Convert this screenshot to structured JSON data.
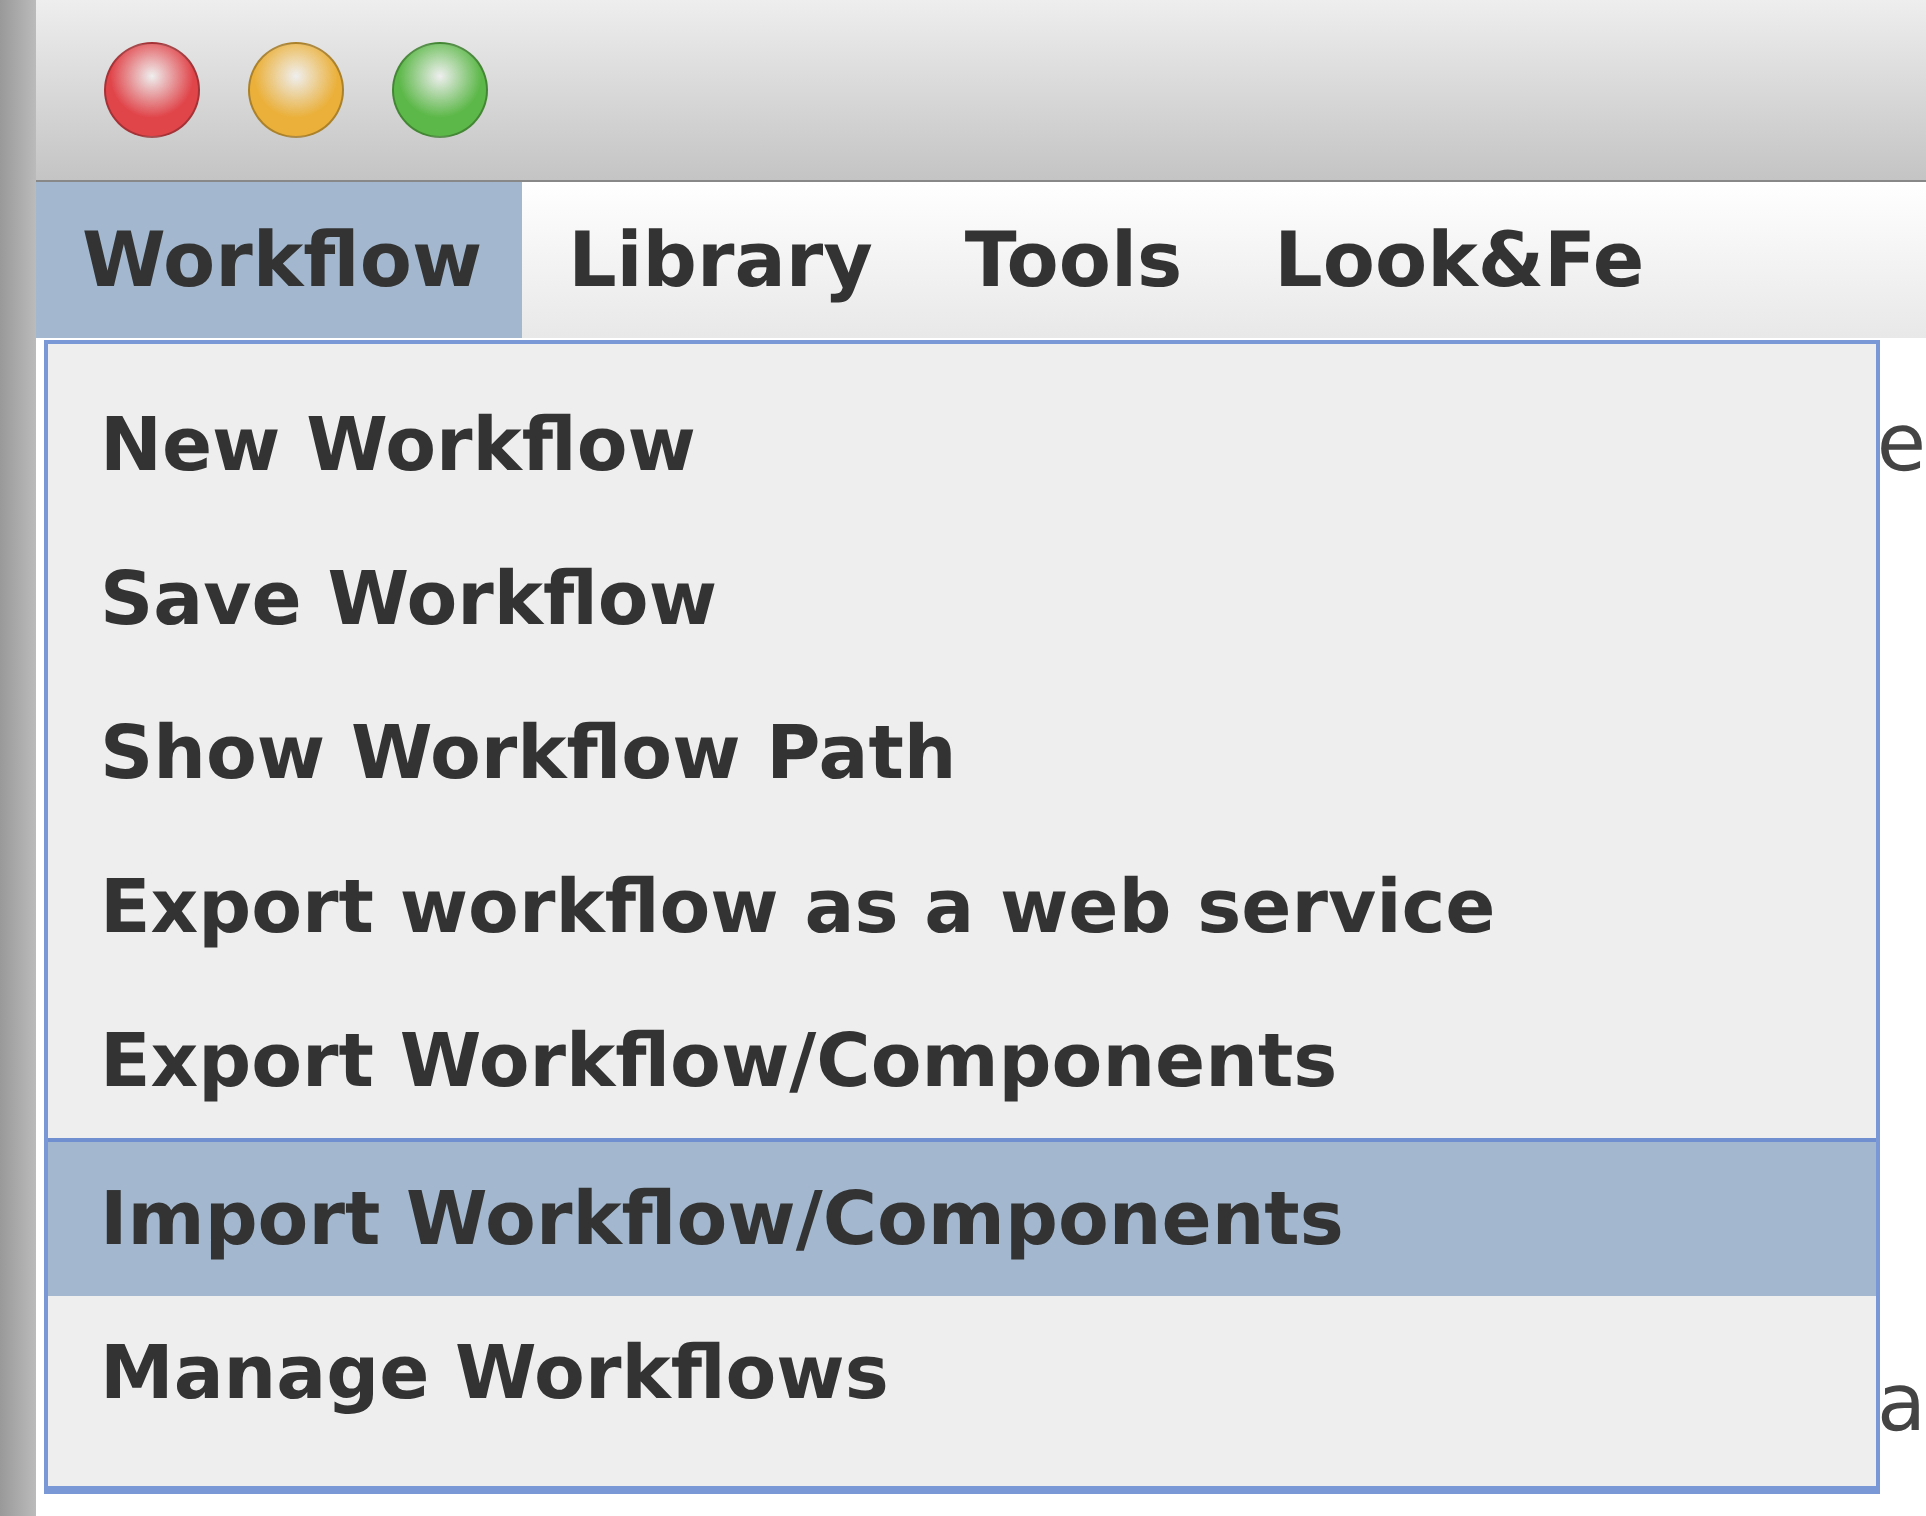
{
  "window": {
    "buttons": [
      {
        "kind": "close"
      },
      {
        "kind": "minimize"
      },
      {
        "kind": "zoom"
      }
    ]
  },
  "menubar": [
    {
      "label": "Workflow",
      "selected": true
    },
    {
      "label": "Library",
      "selected": false
    },
    {
      "label": "Tools",
      "selected": false
    },
    {
      "label": "Look&Fe",
      "selected": false
    }
  ],
  "menu": {
    "items": [
      {
        "label": "New Workflow",
        "selected": false
      },
      {
        "label": "Save Workflow",
        "selected": false
      },
      {
        "label": "Show Workflow Path",
        "selected": false
      },
      {
        "label": "Export workflow as a web service",
        "selected": false
      },
      {
        "label": "Export Workflow/Components",
        "selected": false
      },
      {
        "label": "Import Workflow/Components",
        "selected": true
      },
      {
        "label": "Manage Workflows",
        "selected": false
      }
    ]
  },
  "background_fragments": [
    "e",
    "a"
  ]
}
